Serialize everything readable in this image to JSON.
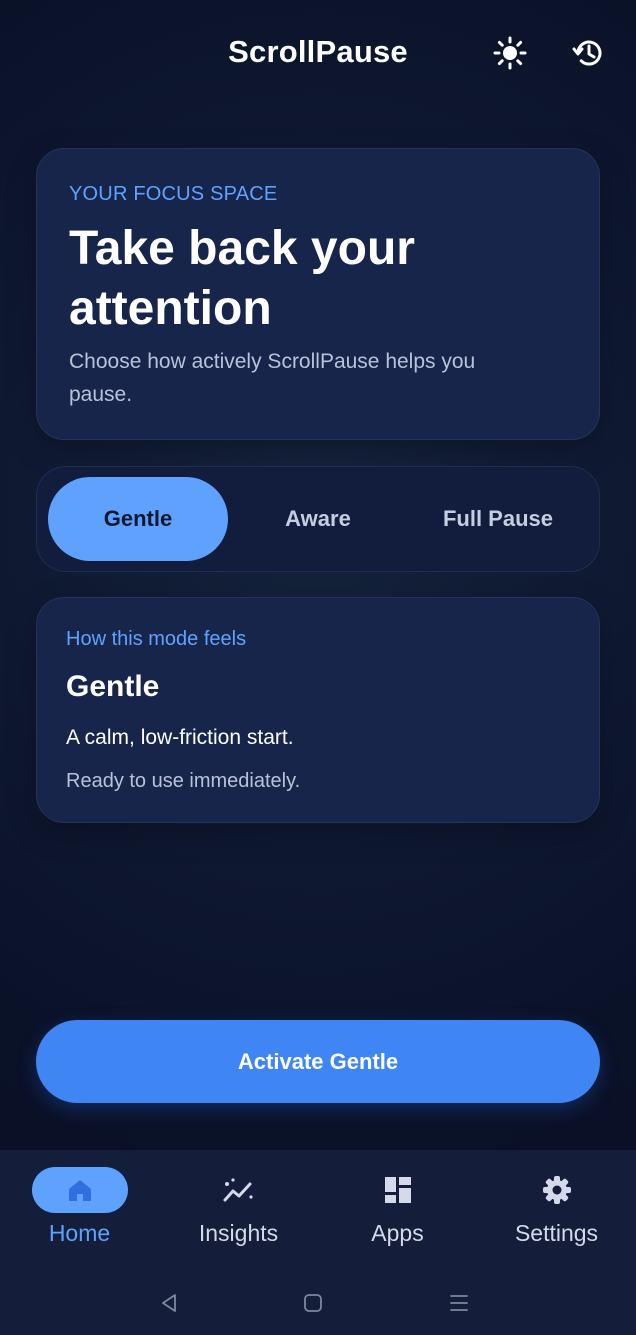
{
  "app": {
    "title": "ScrollPause"
  },
  "header": {
    "icons": [
      "sun-icon",
      "history-icon"
    ]
  },
  "hero": {
    "eyebrow": "YOUR FOCUS SPACE",
    "title": "Take back your attention",
    "subtitle": "Choose how actively ScrollPause helps you pause."
  },
  "modes": {
    "selected": "Gentle",
    "options": [
      {
        "label": "Gentle",
        "active": true
      },
      {
        "label": "Aware",
        "active": false
      },
      {
        "label": "Full Pause",
        "active": false
      }
    ]
  },
  "mode_card": {
    "eyebrow": "How this mode feels",
    "title": "Gentle",
    "description": "A calm, low-friction start.",
    "status": "Ready to use immediately."
  },
  "primary_action": {
    "label": "Activate Gentle"
  },
  "bottom_nav": {
    "items": [
      {
        "label": "Home",
        "icon": "home-icon",
        "active": true
      },
      {
        "label": "Insights",
        "icon": "insights-icon",
        "active": false
      },
      {
        "label": "Apps",
        "icon": "apps-grid-icon",
        "active": false
      },
      {
        "label": "Settings",
        "icon": "gear-icon",
        "active": false
      }
    ]
  },
  "system_nav": {
    "icons": [
      "back-icon",
      "home-square-icon",
      "menu-lines-icon"
    ]
  },
  "colors": {
    "accent": "#5ea1ff",
    "primary_button": "#3f86f4",
    "card": "#17254a",
    "background": "#0a1228"
  }
}
